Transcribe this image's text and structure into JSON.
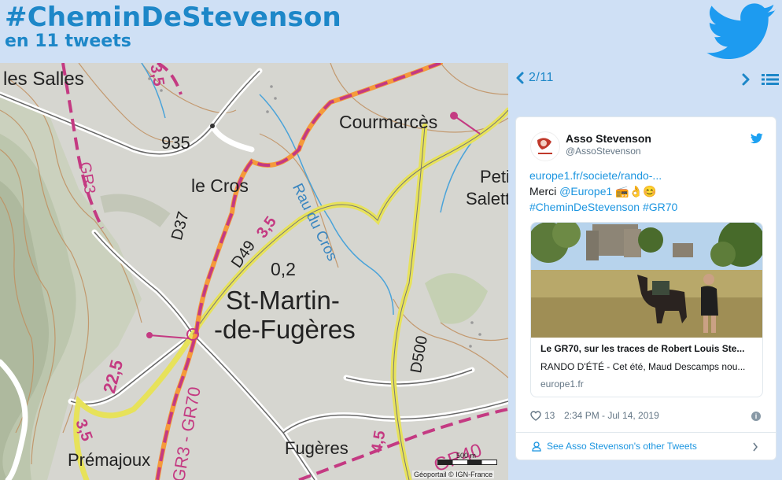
{
  "header": {
    "title": "#CheminDeStevenson",
    "subtitle": "en 11 tweets",
    "logo_icon": "twitter-bird-icon",
    "accent_color": "#1d87c8",
    "background_color": "#cfe0f5"
  },
  "map": {
    "labels": {
      "les_salles": "les Salles",
      "coumarces": "Courmarcès",
      "cros_935": "935",
      "le_cros": "le Cros",
      "rau_du_cros": "Rau du Cros",
      "peti": "Peti",
      "salett": "Salett",
      "d37": "D37",
      "d49": "D49",
      "d49_dist": "3,5",
      "gr3_top": "GR3",
      "alt_02": "0,2",
      "st_martin": "St-Martin-",
      "de_fugeres": "-de-Fugères",
      "d500": "D500",
      "km_225": "22,5",
      "gr70": "GR3 - GR70",
      "km_35": "3,5",
      "km_45": "4,5",
      "gr40": "GR40",
      "premajoux": "Prémajoux",
      "fugeres": "Fugères",
      "top_35": "3,5"
    },
    "scale_label": "500 m",
    "attribution": "Géoportail © IGN-France"
  },
  "pager": {
    "current": "2/11",
    "prev_icon": "chevron-left-icon",
    "next_icon": "chevron-right-icon",
    "list_icon": "list-icon"
  },
  "tweet": {
    "author_name": "Asso Stevenson",
    "author_handle": "@AssoStevenson",
    "link_text": "europe1.fr/societe/rando-...",
    "merci": "Merci ",
    "mention": "@Europe1",
    "emoji": " 📻👌😊",
    "hashtags": "#CheminDeStevenson #GR70",
    "card_title": "Le GR70, sur les traces de Robert Louis Ste...",
    "card_description": "RANDO D'ÉTÉ - Cet été, Maud Descamps nou...",
    "card_domain": "europe1.fr",
    "likes": "13",
    "timestamp": "2:34 PM - Jul 14, 2019",
    "info_icon": "i",
    "footer_link": "See Asso Stevenson's other Tweets",
    "link_color": "#1b95e0"
  }
}
